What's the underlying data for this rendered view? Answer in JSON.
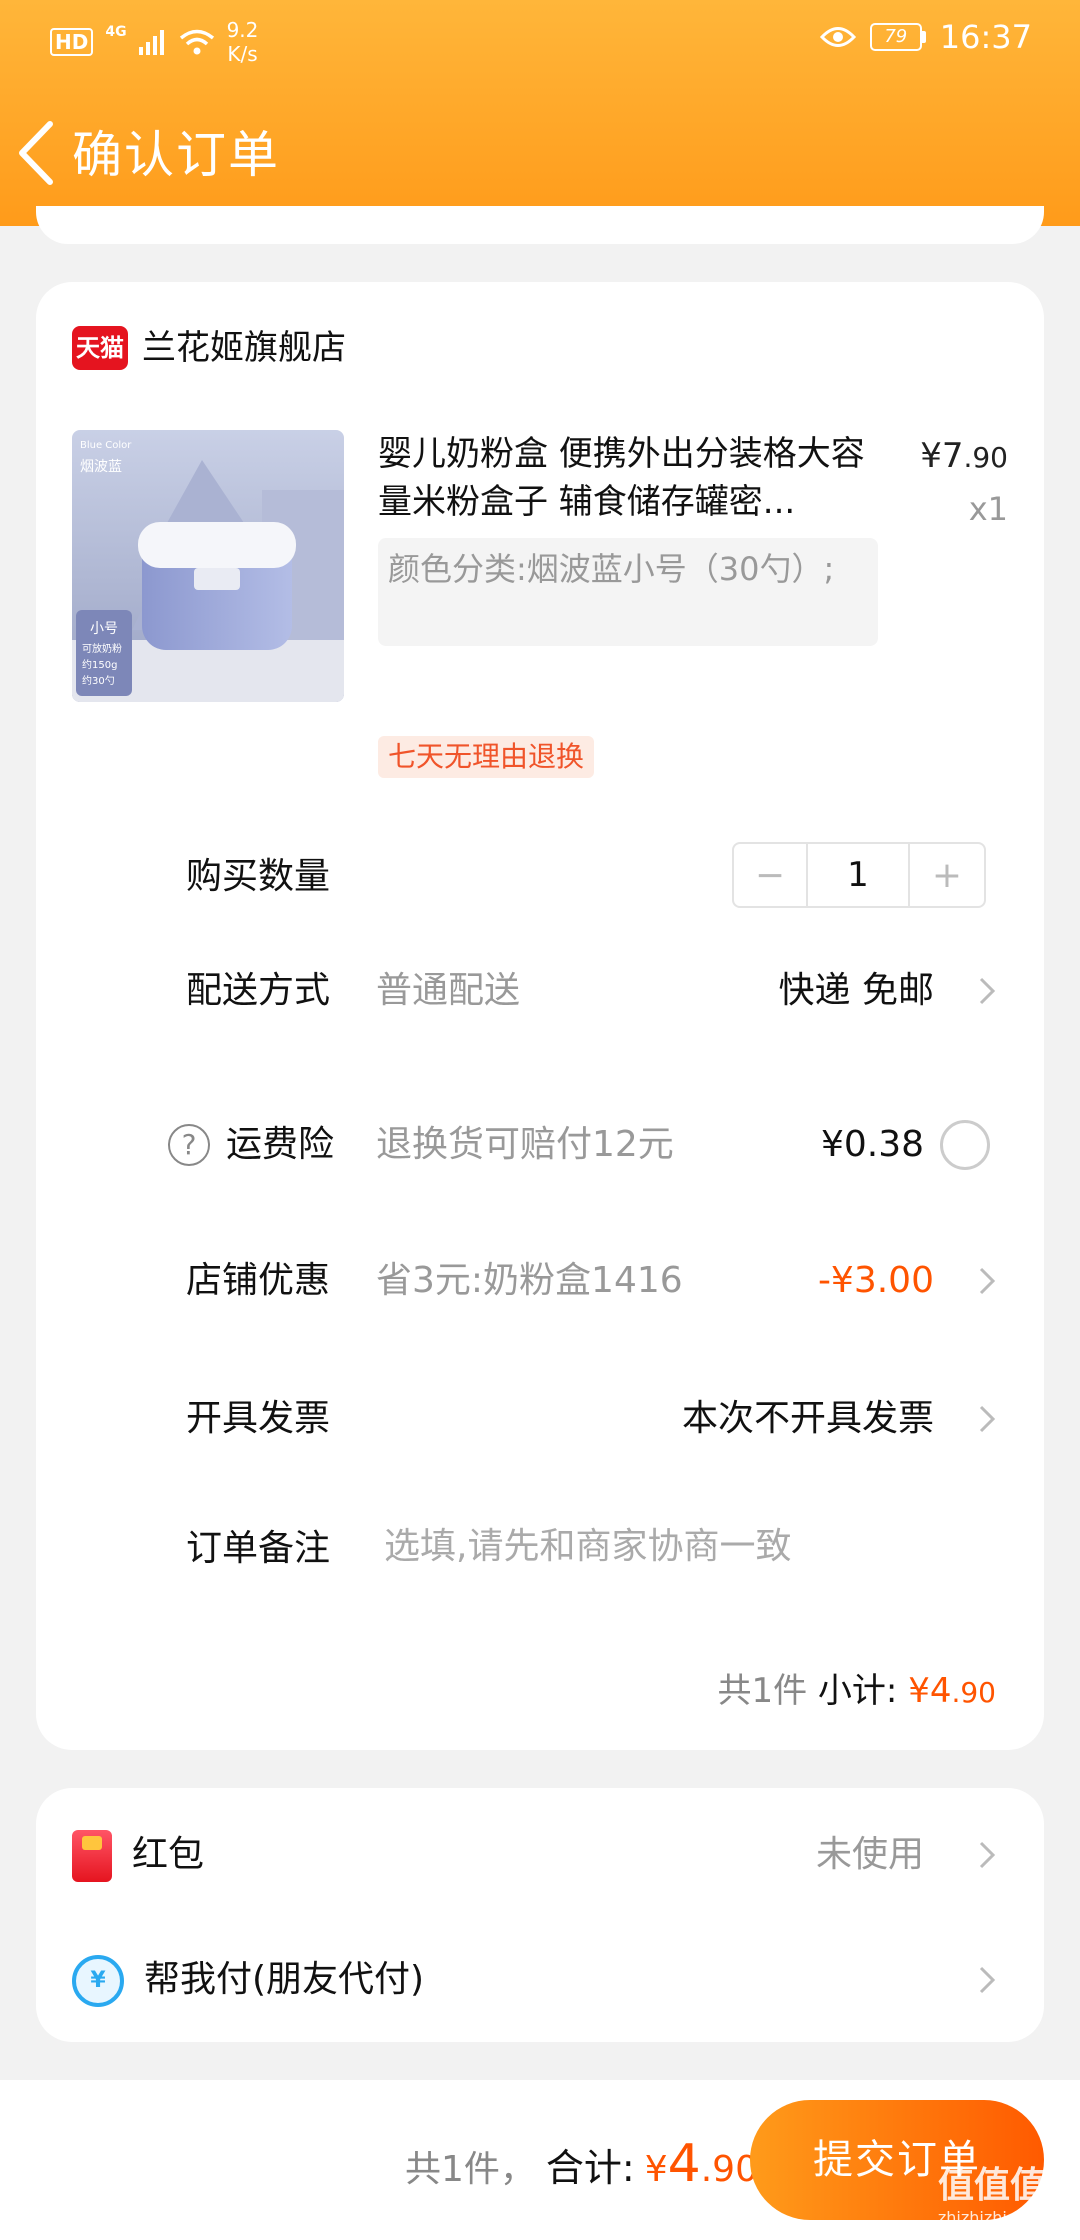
{
  "statusbar": {
    "hd": "HD",
    "network": "4G",
    "speed_value": "9.2",
    "speed_unit": "K/s",
    "battery": "79",
    "time": "16:37"
  },
  "nav": {
    "title": "确认订单"
  },
  "store": {
    "badge": "天猫",
    "name": "兰花姬旗舰店",
    "product": {
      "thumb_caption_en": "Blue Color",
      "thumb_caption_cn": "烟波蓝",
      "thumb_size": "小号",
      "thumb_spec1": "可放奶粉",
      "thumb_spec2": "约150g",
      "thumb_spec3": "约30勺",
      "title": "婴儿奶粉盒 便携外出分装格大容量米粉盒子 辅食储存罐密...",
      "price_symbol": "¥",
      "price_int": "7",
      "price_dec": ".90",
      "qty": "x1",
      "sku": "颜色分类:烟波蓝小号（30勺）;",
      "return_tag": "七天无理由退换"
    },
    "rows": {
      "quantity_label": "购买数量",
      "quantity_value": "1",
      "minus": "−",
      "plus": "+",
      "delivery_label": "配送方式",
      "delivery_method": "普通配送",
      "delivery_value": "快递 免邮",
      "insurance_icon": "?",
      "insurance_label": "运费险",
      "insurance_desc": "退换货可赔付12元",
      "insurance_price": "¥0.38",
      "coupon_label": "店铺优惠",
      "coupon_desc": "省3元:奶粉盒1416",
      "coupon_value": "-¥3.00",
      "invoice_label": "开具发票",
      "invoice_value": "本次不开具发票",
      "note_label": "订单备注",
      "note_placeholder": "选填,请先和商家协商一致"
    },
    "subtotal": {
      "count": "共1件",
      "label": "小计:",
      "symbol": "¥",
      "int": "4",
      "dec": ".90"
    }
  },
  "extras": {
    "hongbao_label": "红包",
    "hongbao_value": "未使用",
    "pay_icon": "¥",
    "friend_pay_label": "帮我付(朋友代付)"
  },
  "footer": {
    "count": "共1件，",
    "total_label": "合计:",
    "symbol": "¥",
    "int": "4",
    "dec": ".90",
    "submit": "提交订单"
  },
  "watermark": {
    "big": "值值值",
    "small": "zhizhizhi.com"
  },
  "colors": {
    "header_orange": "#ffa928",
    "accent_price": "#ff5400",
    "tmall_red": "#e5141f"
  }
}
